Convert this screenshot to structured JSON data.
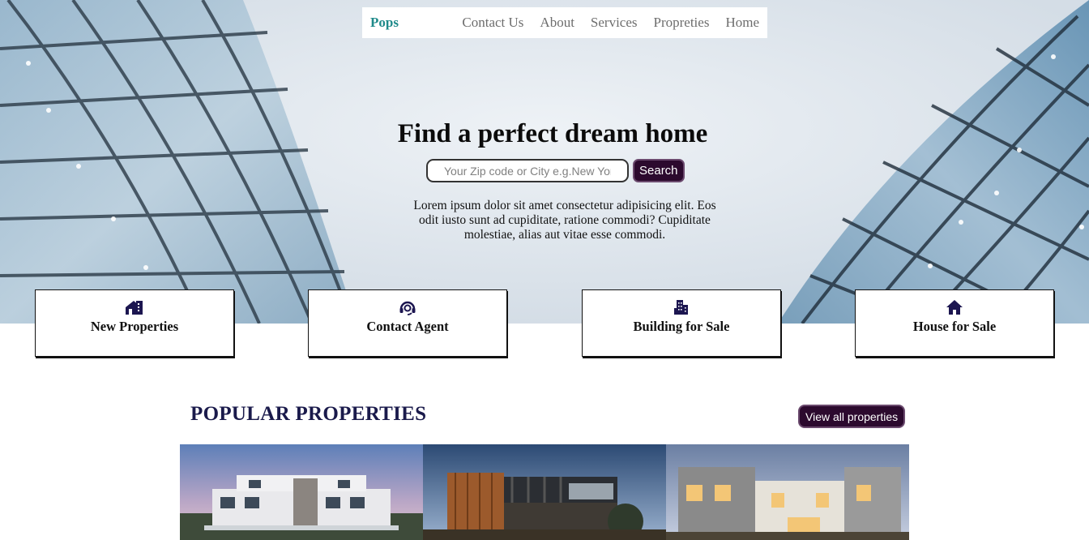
{
  "nav": {
    "brand": "Pops",
    "links": [
      "Contact Us",
      "About",
      "Services",
      "Propreties",
      "Home"
    ]
  },
  "hero": {
    "title": "Find a perfect dream home",
    "search_placeholder": "Your Zip code or City e.g.New York",
    "search_button": "Search",
    "description": "Lorem ipsum dolor sit amet consectetur adipisicing elit. Eos odit iusto sunt ad cupiditate, ratione commodi? Cupiditate molestiae, alias aut vitae esse commodi."
  },
  "cards": [
    {
      "label": "New Properties",
      "icon": "house-chart-icon"
    },
    {
      "label": "Contact Agent",
      "icon": "headset-icon"
    },
    {
      "label": "Building for Sale",
      "icon": "building-icon"
    },
    {
      "label": "House for Sale",
      "icon": "house-icon"
    }
  ],
  "popular": {
    "title": "POPULAR PROPERTIES",
    "view_all": "View all properties"
  },
  "colors": {
    "brand": "#1f8a8a",
    "accent_dark": "#2c0a2e",
    "heading_navy": "#1a1a4b",
    "icon_navy": "#1c1650"
  }
}
